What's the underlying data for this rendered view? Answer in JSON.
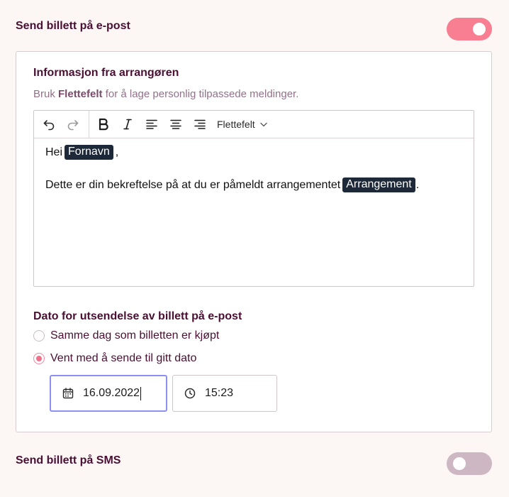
{
  "email_section": {
    "title": "Send billett på e-post",
    "toggle_on": true
  },
  "organizer_info": {
    "title": "Informasjon fra arrangøren",
    "help_prefix": "Bruk",
    "help_bold": "Flettefelt",
    "help_suffix": "for å lage personlig tilpassede meldinger."
  },
  "editor": {
    "toolbar": {
      "icons": [
        "undo-icon",
        "redo-icon",
        "bold-icon",
        "italic-icon",
        "align-left-icon",
        "align-center-icon",
        "align-right-icon"
      ],
      "merge_label": "Flettefelt"
    },
    "line1": {
      "prefix": "Hei",
      "chip": "Fornavn",
      "suffix": ","
    },
    "line2": {
      "prefix": "Dette er din bekreftelse på at du er påmeldt arrangementet",
      "chip": "Arrangement",
      "suffix": "."
    }
  },
  "send_date": {
    "title": "Dato for utsendelse av billett på e-post",
    "options": [
      {
        "label": "Samme dag som billetten er kjøpt",
        "checked": false
      },
      {
        "label": "Vent med å sende til gitt dato",
        "checked": true
      }
    ],
    "date_value": "16.09.2022",
    "time_value": "15:23"
  },
  "sms_section": {
    "title": "Send billett på SMS",
    "toggle_on": false
  },
  "colors": {
    "accent": "#f87e92",
    "title": "#4a0f33",
    "chip": "#1d2838",
    "focus": "#8d8ff2"
  }
}
